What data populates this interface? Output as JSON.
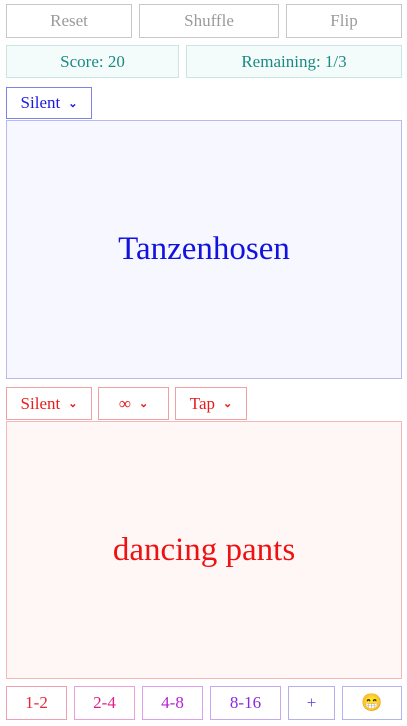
{
  "toolbar": {
    "reset_label": "Reset",
    "shuffle_label": "Shuffle",
    "flip_label": "Flip"
  },
  "status": {
    "score_text": "Score: 20",
    "remaining_text": "Remaining: 1/3"
  },
  "top_card": {
    "voice_select": "Silent",
    "word": "Tanzenhosen"
  },
  "bottom_card": {
    "voice_select": "Silent",
    "repeat_select": "∞",
    "mode_select": "Tap",
    "word": "dancing pants"
  },
  "levels": [
    {
      "label": "1-2"
    },
    {
      "label": "2-4"
    },
    {
      "label": "4-8"
    },
    {
      "label": "8-16"
    },
    {
      "label": "+"
    },
    {
      "label": "😁"
    }
  ],
  "colors": {
    "top_text": "#1212de",
    "bottom_text": "#ee1111",
    "info_text": "#1a8a84"
  }
}
